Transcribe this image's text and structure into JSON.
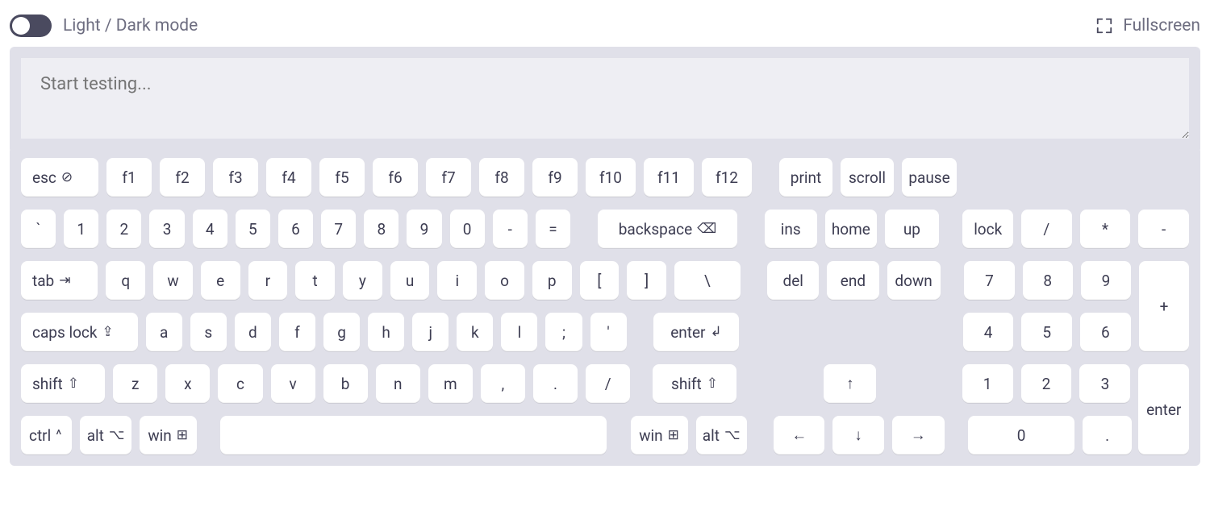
{
  "topbar": {
    "mode_label": "Light / Dark mode",
    "fullscreen_label": "Fullscreen"
  },
  "tester": {
    "placeholder": "Start testing..."
  },
  "keys": {
    "esc": "esc",
    "f1": "f1",
    "f2": "f2",
    "f3": "f3",
    "f4": "f4",
    "f5": "f5",
    "f6": "f6",
    "f7": "f7",
    "f8": "f8",
    "f9": "f9",
    "f10": "f10",
    "f11": "f11",
    "f12": "f12",
    "print": "print",
    "scroll": "scroll",
    "pause": "pause",
    "backtick": "`",
    "k1": "1",
    "k2": "2",
    "k3": "3",
    "k4": "4",
    "k5": "5",
    "k6": "6",
    "k7": "7",
    "k8": "8",
    "k9": "9",
    "k0": "0",
    "dash": "-",
    "equal": "=",
    "backspace": "backspace",
    "ins": "ins",
    "home": "home",
    "up": "up",
    "lock": "lock",
    "numdiv": "/",
    "nummul": "*",
    "numsub": "-",
    "tab": "tab",
    "q": "q",
    "w": "w",
    "e": "e",
    "r": "r",
    "t": "t",
    "y": "y",
    "u": "u",
    "i": "i",
    "o": "o",
    "p": "p",
    "lbr": "[",
    "rbr": "]",
    "bslash": "\\",
    "del": "del",
    "end": "end",
    "down": "down",
    "np7": "7",
    "np8": "8",
    "np9": "9",
    "npplus": "+",
    "caps": "caps lock",
    "a": "a",
    "s": "s",
    "d": "d",
    "f": "f",
    "g": "g",
    "h": "h",
    "j": "j",
    "k": "k",
    "l": "l",
    "semi": ";",
    "apos": "'",
    "enter": "enter",
    "np4": "4",
    "np5": "5",
    "np6": "6",
    "lshift": "shift",
    "z": "z",
    "x": "x",
    "c": "c",
    "v": "v",
    "b": "b",
    "n": "n",
    "m": "m",
    "comma": ",",
    "period": ".",
    "fslash": "/",
    "rshift": "shift",
    "arrowup": "↑",
    "np1": "1",
    "np2": "2",
    "np3": "3",
    "npenter": "enter",
    "lctrl": "ctrl",
    "lalt": "alt",
    "lwin": "win",
    "rwin": "win",
    "ralt": "alt",
    "arrowleft": "←",
    "arrowdown": "↓",
    "arrowright": "→",
    "np0": "0",
    "npdot": "."
  },
  "glyph": {
    "esc": "⊘",
    "backspace": "⌫",
    "tab": "⇥",
    "caps": "⇪",
    "shift": "⇧",
    "ctrl": "^",
    "alt": "⌥",
    "win": "⊞",
    "enter": "↲"
  }
}
